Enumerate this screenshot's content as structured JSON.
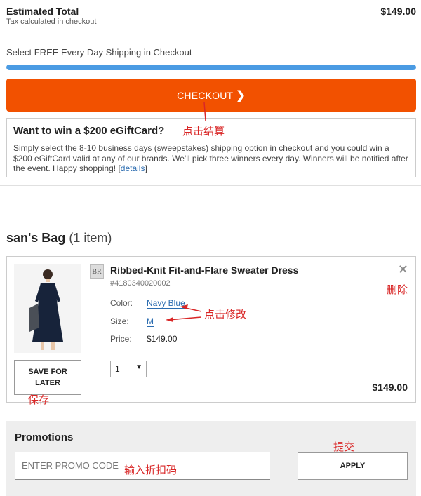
{
  "summary": {
    "title": "Estimated Total",
    "subtitle": "Tax calculated in checkout",
    "total": "$149.00"
  },
  "shipping": {
    "message": "Select FREE Every Day Shipping in Checkout",
    "progress_percent": 100
  },
  "checkout": {
    "label": "CHECKOUT",
    "chevron": "❯"
  },
  "egift": {
    "title": "Want to win a $200 eGiftCard?",
    "body": "Simply select the 8-10 business days (sweepstakes) shipping option in checkout and you could win a $200 eGiftCard valid at any of our brands. We'll pick three winners every day. Winners will be notified after the event. Happy shopping! [",
    "link": "details",
    "close_bracket": "]"
  },
  "bag": {
    "owner": "san's Bag",
    "count": "(1 item)"
  },
  "item": {
    "brand_icon": "BR",
    "name": "Ribbed-Knit Fit-and-Flare Sweater Dress",
    "sku": "#4180340020002",
    "color_label": "Color:",
    "color_value": "Navy Blue",
    "size_label": "Size:",
    "size_value": "M",
    "price_label": "Price:",
    "price_value": "$149.00",
    "qty": "1",
    "qty_caret": "▼",
    "total": "$149.00",
    "save_label_line1": "SAVE FOR",
    "save_label_line2": "LATER",
    "remove_icon": "✕"
  },
  "promo": {
    "title": "Promotions",
    "placeholder": "ENTER PROMO CODE",
    "apply_label": "APPLY"
  },
  "annotations": {
    "checkout": "点击结算",
    "delete": "删除",
    "modify": "点击修改",
    "save": "保存",
    "submit": "提交",
    "promo_input": "输入折扣码"
  },
  "colors": {
    "checkout_orange": "#f25100",
    "progress_blue": "#4a9be3",
    "annotation_red": "#d92727",
    "link_blue": "#2b6cb0"
  }
}
